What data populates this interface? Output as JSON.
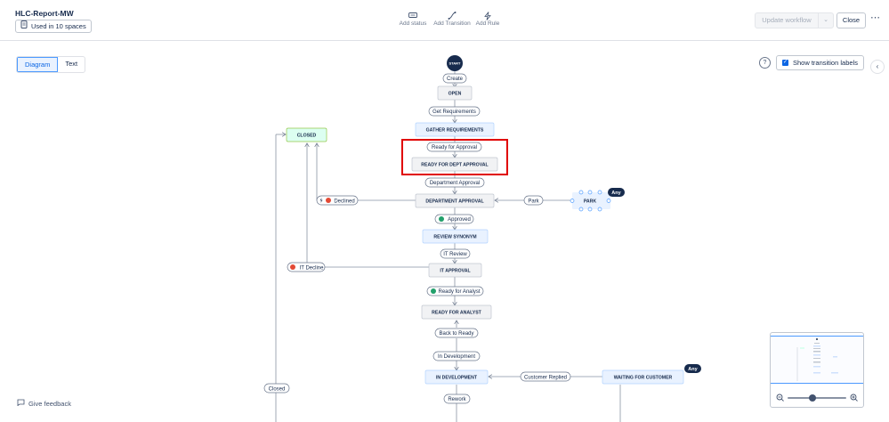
{
  "header": {
    "title": "HLC-Report-MW",
    "used_in": "Used in 10 spaces",
    "toolbar": {
      "add_status": "Add status",
      "add_transition": "Add Transition",
      "add_rule": "Add Rule"
    },
    "update_workflow": "Update workflow",
    "close": "Close"
  },
  "view_toggle": {
    "diagram": "Diagram",
    "text": "Text",
    "active": "Diagram"
  },
  "show_transition_labels": {
    "label": "Show transition labels",
    "checked": true
  },
  "diagram": {
    "start": "START",
    "statuses": {
      "open": "OPEN",
      "gather_requirements": "GATHER REQUIREMENTS",
      "ready_for_dept_approval": "READY FOR DEPT APPROVAL",
      "department_approval": "DEPARTMENT APPROVAL",
      "review_synonym": "REVIEW SYNONYM",
      "it_approval": "IT APPROVAL",
      "ready_for_analyst": "READY FOR ANALYST",
      "in_development": "IN DEVELOPMENT",
      "waiting_for_customer": "WAITING FOR CUSTOMER",
      "closed": "CLOSED",
      "park": "PARK"
    },
    "transitions": {
      "create": "Create",
      "get_requirements": "Get Requirements",
      "ready_for_approval": "Ready for Approval",
      "department_approval": "Department Approval",
      "approved": "Approved",
      "it_review": "IT Review",
      "ready_for_analyst": "Ready for Analyst",
      "back_to_ready": "Back to Ready",
      "in_development": "In Development",
      "rework": "Rework",
      "declined": "Declined",
      "it_decline": "IT Decline",
      "park": "Park",
      "customer_replied": "Customer Replied",
      "closed": "Closed"
    },
    "any_badge": "Any",
    "highlight_color": "#e00000"
  },
  "footer": {
    "feedback": "Give feedback"
  }
}
